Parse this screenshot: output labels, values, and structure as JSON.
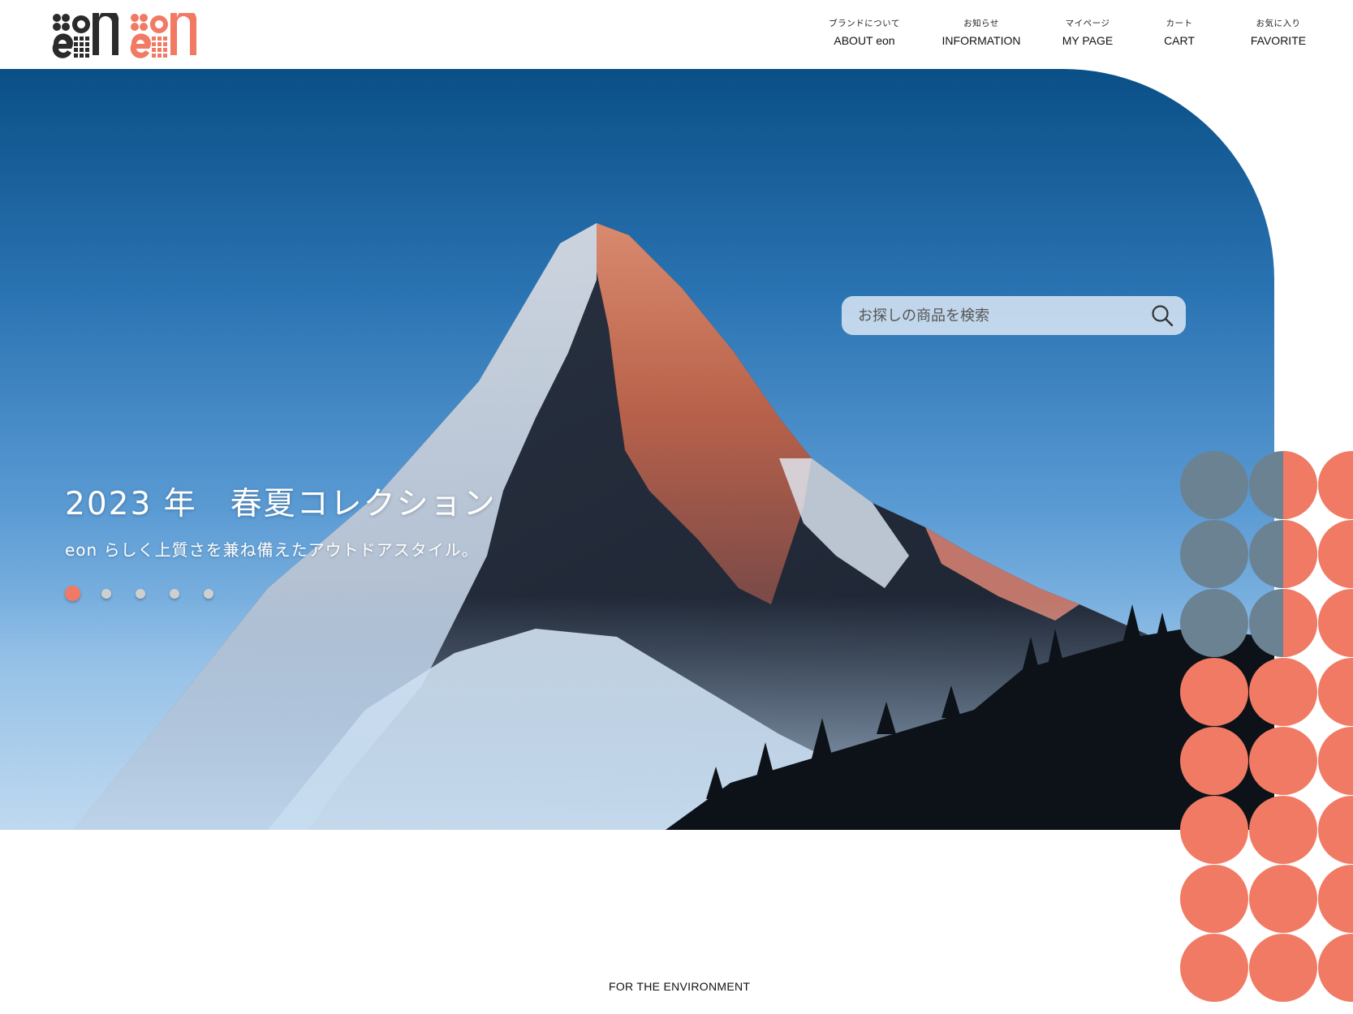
{
  "brand": {
    "name": "eon",
    "accent": "#f17a64",
    "dark": "#2b2b2b"
  },
  "nav": [
    {
      "jp": "ブランドについて",
      "en": "ABOUT eon"
    },
    {
      "jp": "お知らせ",
      "en": "INFORMATION"
    },
    {
      "jp": "マイページ",
      "en": "MY PAGE"
    },
    {
      "jp": "カート",
      "en": "CART"
    },
    {
      "jp": "お気に入り",
      "en": "FAVORITE"
    }
  ],
  "hero": {
    "title": "2023 年　春夏コレクション",
    "subtitle": "eon らしく上質さを兼ね備えたアウトドアスタイル。",
    "slides_total": 5,
    "active_slide": 1
  },
  "search": {
    "placeholder": "お探しの商品を検索",
    "icon": "search-icon"
  },
  "footer": {
    "tagline": "FOR THE ENVIRONMENT"
  },
  "decor": {
    "circle_color": "#f17a64",
    "overlay_color": "#6b8293"
  }
}
